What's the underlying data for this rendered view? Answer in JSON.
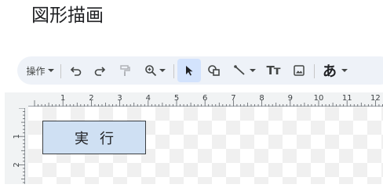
{
  "page": {
    "title": "図形描画"
  },
  "toolbar": {
    "actions_label": "操作",
    "kana_label": "あ",
    "text_tool_label": "Tт",
    "icons": {
      "undo": "undo-icon",
      "redo": "redo-icon",
      "paint_format": "paint-format-icon",
      "zoom": "zoom-icon",
      "select": "select-cursor-icon",
      "shape": "shape-icon",
      "line": "line-icon",
      "text_box": "text-box-icon",
      "image": "image-icon"
    },
    "active_tool": "select"
  },
  "ruler": {
    "horizontal": [
      "1",
      "2",
      "3",
      "4",
      "5",
      "6",
      "7",
      "8",
      "9",
      "10",
      "11",
      "12"
    ],
    "vertical": [
      "1",
      "2"
    ]
  },
  "drawing": {
    "button_label": "実行",
    "button_fill": "#cfe0f3",
    "button_border": "#3c4043"
  },
  "colors": {
    "toolbar_bg": "#eef2f8",
    "active_tool_bg": "#d3e3fd",
    "canvas_bg": "#f1f3f4"
  }
}
